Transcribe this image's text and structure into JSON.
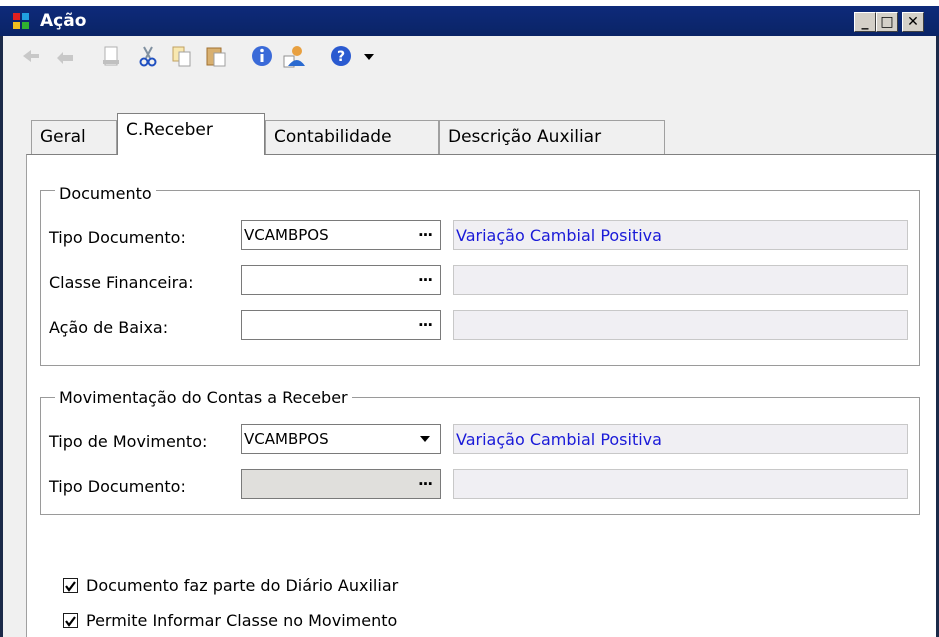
{
  "window": {
    "title": "Ação",
    "controls": {
      "minimize": "_",
      "maximize": "□",
      "close": "✕"
    }
  },
  "toolbar": {
    "icons": [
      "first-record-icon",
      "previous-record-icon",
      "new-document-icon",
      "cut-icon",
      "copy-icon",
      "paste-icon",
      "info-icon",
      "user-icon",
      "help-icon",
      "dropdown-arrow-icon"
    ]
  },
  "tabs": [
    {
      "label": "Geral"
    },
    {
      "label": "C.Receber"
    },
    {
      "label": "Contabilidade"
    },
    {
      "label": "Descrição Auxiliar"
    }
  ],
  "active_tab": "C.Receber",
  "documento": {
    "legend": "Documento",
    "tipo_documento": {
      "label": "Tipo Documento:",
      "value": "VCAMBPOS",
      "description": "Variação Cambial Positiva"
    },
    "classe_financeira": {
      "label": "Classe Financeira:",
      "value": "",
      "description": ""
    },
    "acao_de_baixa": {
      "label": "Ação de Baixa:",
      "value": "",
      "description": ""
    }
  },
  "movimentacao": {
    "legend": "Movimentação do Contas a Receber",
    "tipo_movimento": {
      "label": "Tipo de Movimento:",
      "value": "VCAMBPOS",
      "description": "Variação Cambial Positiva"
    },
    "tipo_documento": {
      "label": "Tipo Documento:",
      "value": "",
      "description": ""
    }
  },
  "checkboxes": [
    {
      "label": "Documento faz parte do Diário Auxiliar",
      "checked": true
    },
    {
      "label": "Permite Informar Classe no Movimento",
      "checked": true
    }
  ],
  "ellipsis": "...",
  "colors": {
    "titlebar": "#0b246a",
    "link_text": "#1a1ad8"
  }
}
